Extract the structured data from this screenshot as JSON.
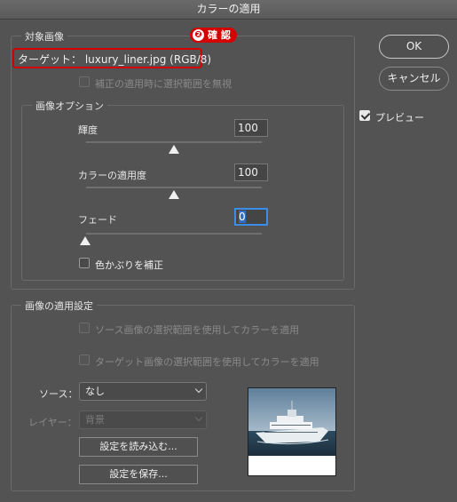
{
  "window": {
    "title": "カラーの適用"
  },
  "target_image": {
    "legend": "対象画像",
    "target_label": "ターゲット： luxury_liner.jpg (RGB/8)",
    "annotation_number": "❷",
    "annotation_text": "確 認",
    "ignore_selection_label": "補正の適用時に選択範囲を無視"
  },
  "image_options": {
    "legend": "画像オプション",
    "luminance": {
      "label": "輝度",
      "value": "100",
      "level_fraction": 0.5
    },
    "color_intensity": {
      "label": "カラーの適用度",
      "value": "100",
      "level_fraction": 0.5
    },
    "fade": {
      "label": "フェード",
      "value": "0",
      "level_fraction": 0.0
    },
    "neutralize_label": "色かぶりを補正"
  },
  "image_statistics": {
    "legend": "画像の適用設定",
    "use_source_selection_label": "ソース画像の選択範囲を使用してカラーを適用",
    "use_target_selection_label": "ターゲット画像の選択範囲を使用してカラーを適用",
    "source_label": "ソース：",
    "source_value": "なし",
    "layer_label": "レイヤー：",
    "layer_value": "背景",
    "load_button": "設定を読み込む...",
    "save_button": "設定を保存..."
  },
  "buttons": {
    "ok": "OK",
    "cancel": "キャンセル"
  },
  "preview": {
    "label": "プレビュー",
    "checked": true
  },
  "colors": {
    "accent": "#3a8ee6",
    "annotation_red": "#d40000",
    "panel_bg": "#535353"
  }
}
